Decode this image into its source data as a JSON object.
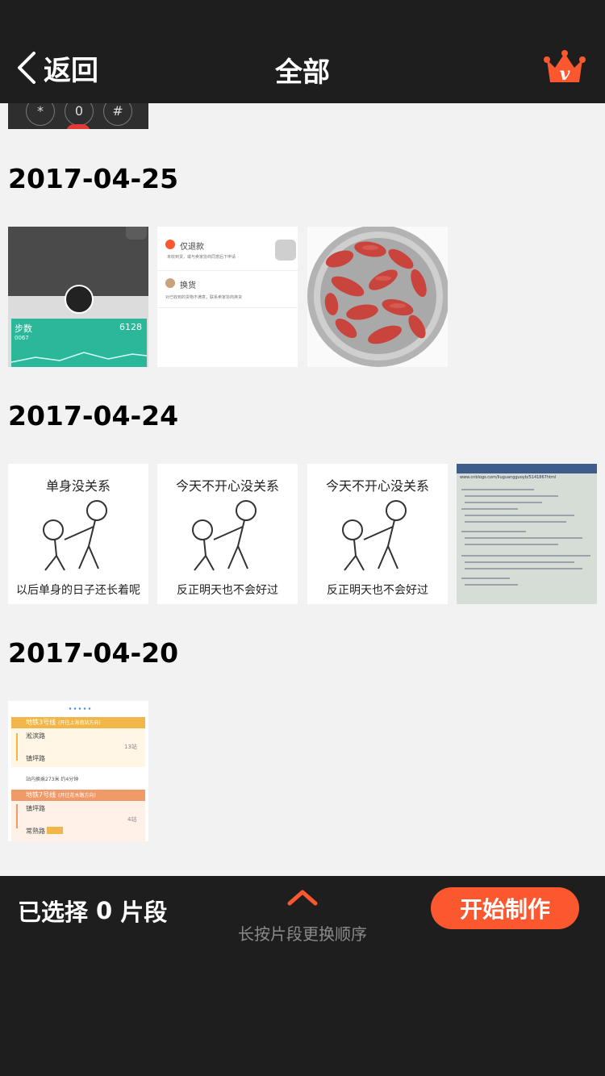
{
  "topbar": {
    "back_label": "返回",
    "title": "全部",
    "vip_icon": "crown-v-icon",
    "accent": "#fb5830"
  },
  "sections": [
    {
      "date": "2017-04-25"
    },
    {
      "date": "2017-04-24"
    },
    {
      "date": "2017-04-20"
    }
  ],
  "thumbs": {
    "partial_keypad": {
      "keys": [
        "*",
        "0",
        "#"
      ]
    },
    "steps_app": {
      "label": "步数",
      "value": "6128",
      "small": "0067"
    },
    "refund_screen": {
      "item1": "仅退款",
      "item1_sub": "未收到货，或与卖家协商同意后下申请",
      "item2": "换货",
      "item2_sub": "对已收到的货物不满意，联系卖家协商换货"
    },
    "meme1": {
      "top": "单身没关系",
      "bottom": "以后单身的日子还长着呢"
    },
    "meme2": {
      "top": "今天不开心没关系",
      "bottom": "反正明天也不会好过"
    },
    "meme3": {
      "top": "今天不开心没关系",
      "bottom": "反正明天也不会好过"
    },
    "code_photo": {
      "url": "www.cnblogs.com/liuguangguoyb/5141867html"
    },
    "metro": {
      "line3": "地铁3号线",
      "line3_dir": "(开往上海南站方向)",
      "stop_a": "淞滨路",
      "stops_a": "13站",
      "stop_b": "镇坪路",
      "transfer": "站内换乘273米 约4分钟",
      "line7": "地铁7号线",
      "line7_dir": "(开往花木路方向)",
      "stop_c": "镇坪路",
      "stops_c": "4站",
      "stop_d": "常熟路"
    }
  },
  "bottombar": {
    "selected_prefix": "已选择",
    "selected_count": "0",
    "selected_suffix": "片段",
    "hint": "长按片段更换顺序",
    "start_label": "开始制作"
  }
}
